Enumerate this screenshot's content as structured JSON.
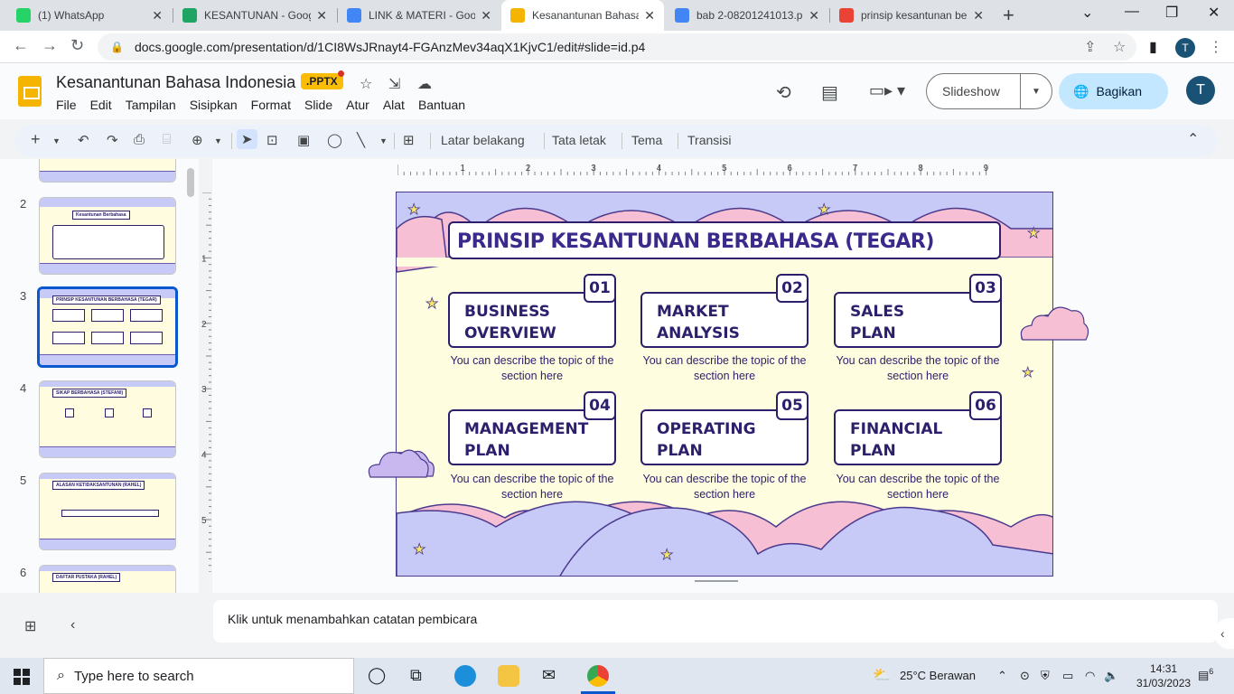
{
  "browser": {
    "tabs": [
      {
        "title": "(1) WhatsApp",
        "color": "#25d366"
      },
      {
        "title": "KESANTUNAN - Goog",
        "color": "#1fa463"
      },
      {
        "title": "LINK & MATERI - Goo",
        "color": "#4285f4"
      },
      {
        "title": "Kesanantunan Bahasa",
        "color": "#f4b400"
      },
      {
        "title": "bab 2-08201241013.p",
        "color": "#4285f4"
      },
      {
        "title": "prinsip kesantunan be",
        "color": "#ea4335"
      }
    ],
    "url": "docs.google.com/presentation/d/1CI8WsJRnayt4-FGAnzMev34aqX1KjvC1/edit#slide=id.p4",
    "profile_initial": "T"
  },
  "app": {
    "title": "Kesanantunan Bahasa Indonesia",
    "badge": ".PPTX",
    "menu": [
      "File",
      "Edit",
      "Tampilan",
      "Sisipkan",
      "Format",
      "Slide",
      "Atur",
      "Alat",
      "Bantuan"
    ],
    "slideshow_label": "Slideshow",
    "share_label": "Bagikan",
    "user_initial": "T"
  },
  "edit_toolbar": {
    "background": "Latar belakang",
    "layout": "Tata letak",
    "theme": "Tema",
    "transition": "Transisi"
  },
  "filmstrip": [
    {
      "num": "2",
      "title": "Kesantunan Berbahasa"
    },
    {
      "num": "3",
      "title": "PRINSIP KESANTUNAN BERBAHASA (TEGAR)"
    },
    {
      "num": "4",
      "title": "SIKAP BERBAHASA (STEFANI)"
    },
    {
      "num": "5",
      "title": "ALASAN KETIDAKSANTUNAN (RAHEL)"
    },
    {
      "num": "6",
      "title": "DAFTAR PUSTAKA (RAHEL)"
    }
  ],
  "ruler": {
    "h_marks": [
      "1",
      "2",
      "3",
      "4",
      "5",
      "6",
      "7",
      "8",
      "9"
    ],
    "v_marks": [
      "1",
      "2",
      "3",
      "4",
      "5"
    ]
  },
  "slide": {
    "title": "PRINSIP KESANTUNAN BERBAHASA (TEGAR)",
    "cards": [
      {
        "num": "01",
        "line1": "BUSINESS",
        "line2": "OVERVIEW",
        "desc": "You can describe the topic of the section here"
      },
      {
        "num": "02",
        "line1": "MARKET",
        "line2": "ANALYSIS",
        "desc": "You can describe the topic of the section here"
      },
      {
        "num": "03",
        "line1": "SALES",
        "line2": "PLAN",
        "desc": "You can describe the topic of the section here"
      },
      {
        "num": "04",
        "line1": "MANAGEMENT",
        "line2": "PLAN",
        "desc": "You can describe the topic of the section here"
      },
      {
        "num": "05",
        "line1": "OPERATING",
        "line2": "PLAN",
        "desc": "You can describe the topic of the section here"
      },
      {
        "num": "06",
        "line1": "FINANCIAL",
        "line2": "PLAN",
        "desc": "You can describe the topic of the section here"
      }
    ]
  },
  "notes_placeholder": "Klik untuk menambahkan catatan pembicara",
  "taskbar": {
    "search_placeholder": "Type here to search",
    "weather": "25°C  Berawan",
    "time": "14:31",
    "date": "31/03/2023",
    "notifications": "6"
  }
}
